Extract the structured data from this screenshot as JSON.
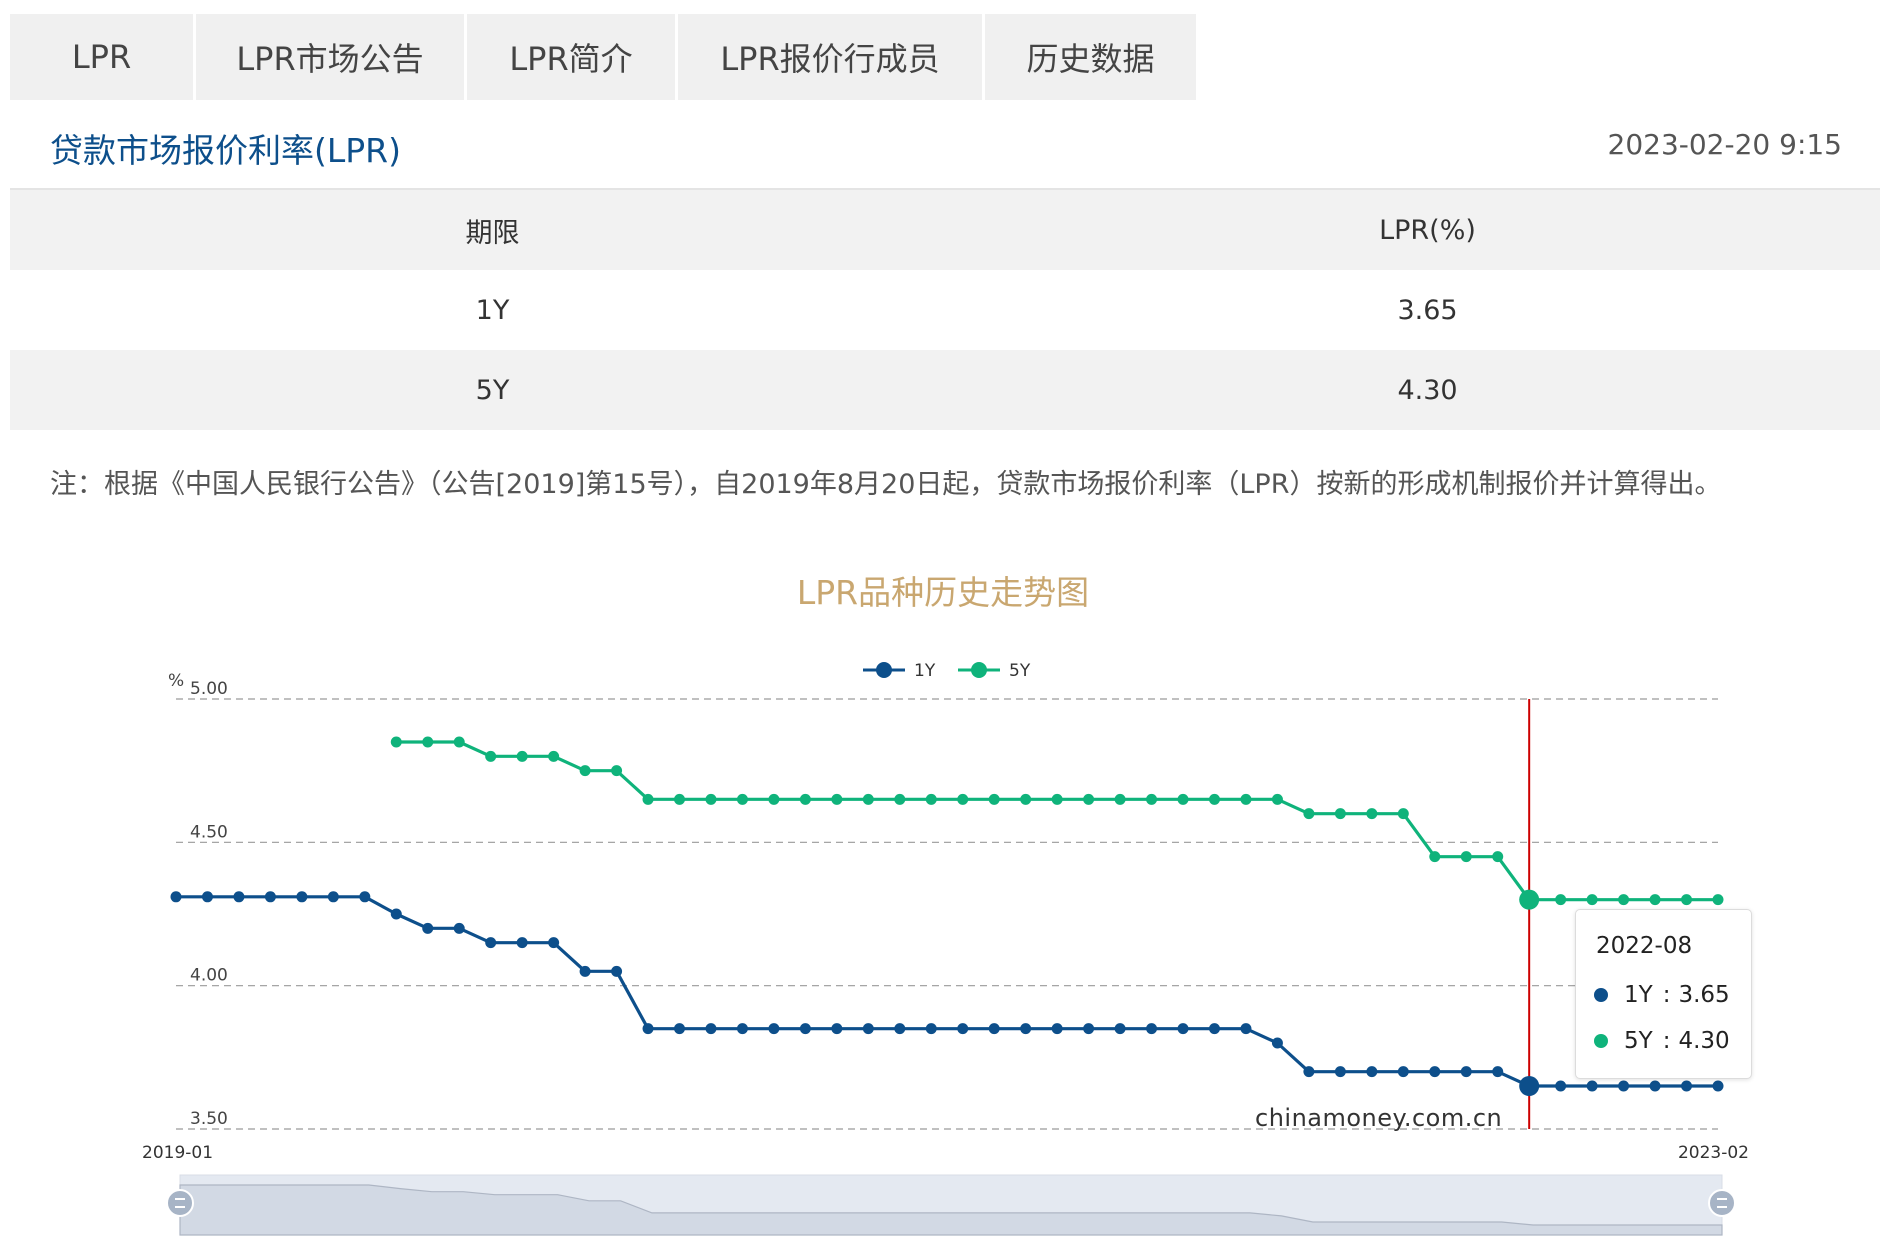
{
  "tabs": [
    {
      "label": "LPR",
      "active": true
    },
    {
      "label": "LPR市场公告",
      "active": false
    },
    {
      "label": "LPR简介",
      "active": false
    },
    {
      "label": "LPR报价行成员",
      "active": false
    },
    {
      "label": "历史数据",
      "active": false
    }
  ],
  "header": {
    "title": "贷款市场报价利率(LPR)",
    "timestamp": "2023-02-20 9:15"
  },
  "rates_table": {
    "headers": [
      "期限",
      "LPR(%)"
    ],
    "rows": [
      {
        "term": "1Y",
        "rate": "3.65"
      },
      {
        "term": "5Y",
        "rate": "4.30"
      }
    ]
  },
  "note": "注：根据《中国人民银行公告》（公告[2019]第15号），自2019年8月20日起，贷款市场报价利率（LPR）按新的形成机制报价并计算得出。",
  "colors": {
    "accent": "#c9a770",
    "series_1y": "#0d4f8b",
    "series_5y": "#0fb37b",
    "crosshair": "#cc0000"
  },
  "tooltip": {
    "date": "2022-08",
    "items": [
      {
        "name": "1Y",
        "sep": ":",
        "value": "3.65"
      },
      {
        "name": "5Y",
        "sep": ":",
        "value": "4.30"
      }
    ]
  },
  "watermark": "chinamoney.com.cn",
  "chart_data": {
    "type": "line",
    "title": "LPR品种历史走势图",
    "y_unit": "%",
    "ylim": [
      3.5,
      5.0
    ],
    "yticks": [
      "5.00",
      "4.50",
      "4.00",
      "3.50"
    ],
    "x_start_label": "2019-01",
    "x_end_label": "2023-02",
    "grid": "dashed horizontal",
    "legend_position": "top-center",
    "highlight_index": 43,
    "x": [
      "2019-01",
      "2019-02",
      "2019-03",
      "2019-04",
      "2019-05",
      "2019-06",
      "2019-07",
      "2019-08",
      "2019-09",
      "2019-10",
      "2019-11",
      "2019-12",
      "2020-01",
      "2020-02",
      "2020-03",
      "2020-04",
      "2020-05",
      "2020-06",
      "2020-07",
      "2020-08",
      "2020-09",
      "2020-10",
      "2020-11",
      "2020-12",
      "2021-01",
      "2021-02",
      "2021-03",
      "2021-04",
      "2021-05",
      "2021-06",
      "2021-07",
      "2021-08",
      "2021-09",
      "2021-10",
      "2021-11",
      "2021-12",
      "2022-01",
      "2022-02",
      "2022-03",
      "2022-04",
      "2022-05",
      "2022-06",
      "2022-07",
      "2022-08",
      "2022-09",
      "2022-10",
      "2022-11",
      "2022-12",
      "2023-01",
      "2023-02"
    ],
    "series": [
      {
        "name": "1Y",
        "values": [
          4.31,
          4.31,
          4.31,
          4.31,
          4.31,
          4.31,
          4.31,
          4.25,
          4.2,
          4.2,
          4.15,
          4.15,
          4.15,
          4.05,
          4.05,
          3.85,
          3.85,
          3.85,
          3.85,
          3.85,
          3.85,
          3.85,
          3.85,
          3.85,
          3.85,
          3.85,
          3.85,
          3.85,
          3.85,
          3.85,
          3.85,
          3.85,
          3.85,
          3.85,
          3.85,
          3.8,
          3.7,
          3.7,
          3.7,
          3.7,
          3.7,
          3.7,
          3.7,
          3.65,
          3.65,
          3.65,
          3.65,
          3.65,
          3.65,
          3.65
        ]
      },
      {
        "name": "5Y",
        "values": [
          null,
          null,
          null,
          null,
          null,
          null,
          null,
          4.85,
          4.85,
          4.85,
          4.8,
          4.8,
          4.8,
          4.75,
          4.75,
          4.65,
          4.65,
          4.65,
          4.65,
          4.65,
          4.65,
          4.65,
          4.65,
          4.65,
          4.65,
          4.65,
          4.65,
          4.65,
          4.65,
          4.65,
          4.65,
          4.65,
          4.65,
          4.65,
          4.65,
          4.65,
          4.6,
          4.6,
          4.6,
          4.6,
          4.45,
          4.45,
          4.45,
          4.3,
          4.3,
          4.3,
          4.3,
          4.3,
          4.3,
          4.3
        ]
      }
    ]
  }
}
